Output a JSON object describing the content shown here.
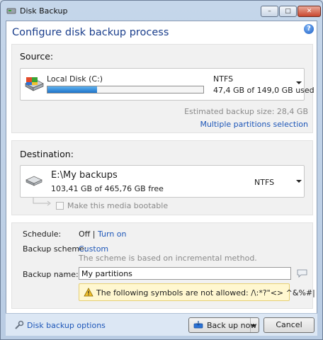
{
  "window": {
    "title": "Disk Backup",
    "buttons": {
      "minimize": "–",
      "maximize": "□",
      "close": "✕"
    }
  },
  "header": {
    "title": "Configure disk backup process",
    "help_icon": "question-icon"
  },
  "source": {
    "label": "Source:",
    "disk_name": "Local Disk (C:)",
    "filesystem": "NTFS",
    "usage_text": "47,4 GB of 149,0 GB used",
    "usage_fraction": 0.318,
    "estimated_size": "Estimated backup size: 28,4 GB",
    "multiple_partitions_link": "Multiple partitions selection"
  },
  "destination": {
    "label": "Destination:",
    "path": "E:\\My backups",
    "free_text": "103,41 GB of 465,76 GB free",
    "filesystem": "NTFS",
    "bootable_label": "Make this media bootable",
    "bootable_checked": false
  },
  "settings": {
    "schedule_label": "Schedule:",
    "schedule_value": "Off",
    "schedule_sep": "|",
    "schedule_link": "Turn on",
    "scheme_label": "Backup scheme:",
    "scheme_value": "Custom",
    "scheme_desc": "The scheme is based on incremental method.",
    "name_label": "Backup name:",
    "name_value": "My partitions",
    "warning_prefix": "The following symbols are not allowed:",
    "warning_symbols": "/\\:*?\"<> ^&%#|"
  },
  "footer": {
    "options_link": "Disk backup options",
    "backup_now": "Back up now",
    "cancel": "Cancel"
  },
  "colors": {
    "accent": "#1d56b8",
    "progress_fill": "#2f86d8",
    "warning_bg": "#fff7d0"
  }
}
